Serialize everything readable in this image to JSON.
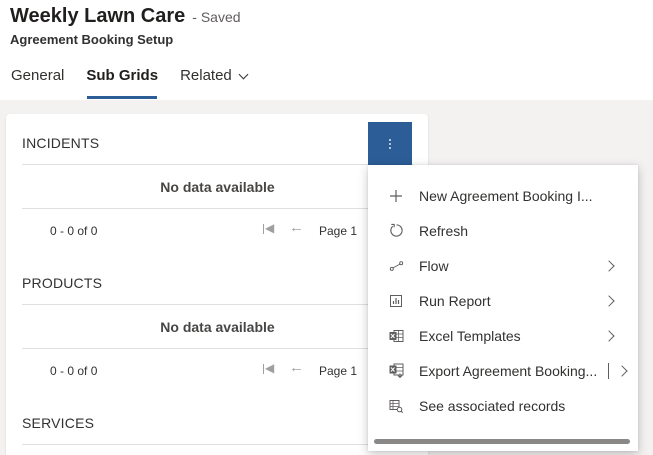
{
  "header": {
    "record_title": "Weekly Lawn Care",
    "saved_status": "- Saved",
    "entity_name": "Agreement Booking Setup"
  },
  "tabs": [
    {
      "label": "General"
    },
    {
      "label": "Sub Grids",
      "active": true
    },
    {
      "label": "Related"
    }
  ],
  "subgrids": [
    {
      "title": "INCIDENTS",
      "empty_text": "No data available",
      "count_text": "0 - 0 of 0",
      "page_text": "Page 1"
    },
    {
      "title": "PRODUCTS",
      "empty_text": "No data available",
      "count_text": "0 - 0 of 0",
      "page_text": "Page 1"
    },
    {
      "title": "SERVICES"
    }
  ],
  "menu": {
    "items": [
      {
        "label": "New Agreement Booking I...",
        "icon": "plus-icon"
      },
      {
        "label": "Refresh",
        "icon": "refresh-icon"
      },
      {
        "label": "Flow",
        "icon": "flow-icon",
        "submenu": true
      },
      {
        "label": "Run Report",
        "icon": "report-icon",
        "submenu": true
      },
      {
        "label": "Excel Templates",
        "icon": "excel-icon",
        "submenu": true
      },
      {
        "label": "Export Agreement Booking...",
        "icon": "excel-export-icon",
        "submenu": true,
        "split": true
      },
      {
        "label": "See associated records",
        "icon": "associated-records-icon"
      }
    ]
  },
  "colors": {
    "accent": "#2c5d96",
    "page_background": "#f3f2f1",
    "card_background": "#ffffff"
  }
}
